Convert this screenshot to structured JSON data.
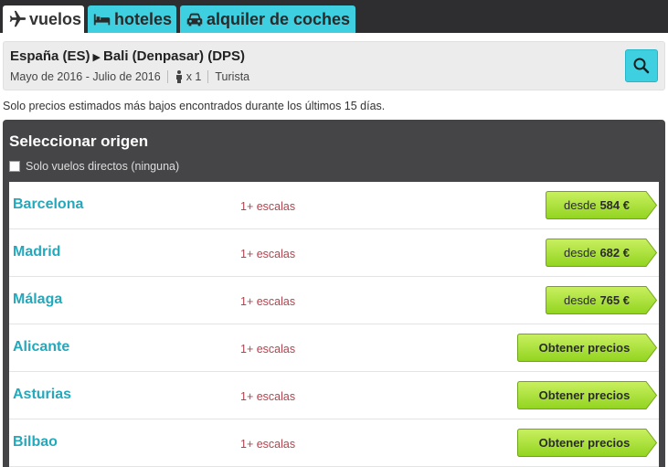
{
  "tabs": [
    {
      "label": "vuelos",
      "icon": "airplane-icon"
    },
    {
      "label": "hoteles",
      "icon": "bed-icon"
    },
    {
      "label": "alquiler de coches",
      "icon": "car-icon"
    }
  ],
  "search": {
    "origin": "España (ES)",
    "destination": "Bali (Denpasar) (DPS)",
    "dates": "Mayo de 2016 - Julio de 2016",
    "passengers": "x 1",
    "cabin": "Turista"
  },
  "note": "Solo precios estimados más bajos encontrados durante los últimos 15 días.",
  "panel": {
    "title": "Seleccionar origen",
    "direct_label": "Solo vuelos directos (ninguna)"
  },
  "origins": [
    {
      "city": "Barcelona",
      "stops": "1+ escalas",
      "price_prefix": "desde",
      "price": "584 €"
    },
    {
      "city": "Madrid",
      "stops": "1+ escalas",
      "price_prefix": "desde",
      "price": "682 €"
    },
    {
      "city": "Málaga",
      "stops": "1+ escalas",
      "price_prefix": "desde",
      "price": "765 €"
    },
    {
      "city": "Alicante",
      "stops": "1+ escalas",
      "action": "Obtener precios"
    },
    {
      "city": "Asturias",
      "stops": "1+ escalas",
      "action": "Obtener precios"
    },
    {
      "city": "Bilbao",
      "stops": "1+ escalas",
      "action": "Obtener precios"
    }
  ],
  "colors": {
    "accent": "#3ecfe0",
    "city": "#23a8bc",
    "stops": "#b2434d",
    "price_button": "#a8e03a",
    "panel": "#454548"
  }
}
